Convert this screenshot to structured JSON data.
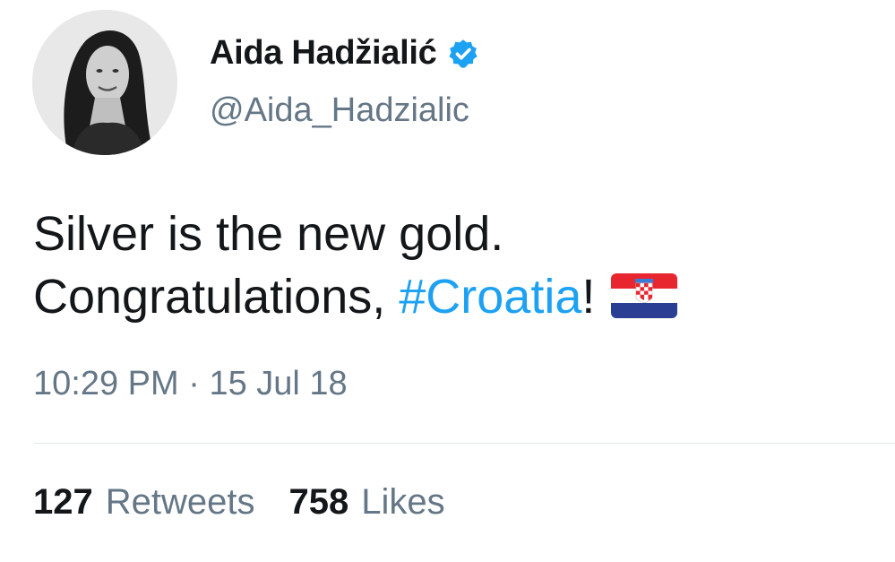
{
  "author": {
    "name": "Aida Hadžialić",
    "handle": "@Aida_Hadzialic",
    "verified": true,
    "avatar_icon": "profile-photo"
  },
  "tweet": {
    "text_line1": "Silver is the new gold.",
    "text_line2_prefix": "Congratulations, ",
    "hashtag": "#Croatia",
    "text_line2_suffix": "!",
    "emoji": "croatia-flag-icon"
  },
  "meta": {
    "time": "10:29 PM",
    "separator": "·",
    "date": "15 Jul 18"
  },
  "stats": {
    "retweets_count": "127",
    "retweets_label": "Retweets",
    "likes_count": "758",
    "likes_label": "Likes"
  },
  "colors": {
    "link": "#1da1f2",
    "secondary_text": "#657786",
    "primary_text": "#14171a"
  }
}
